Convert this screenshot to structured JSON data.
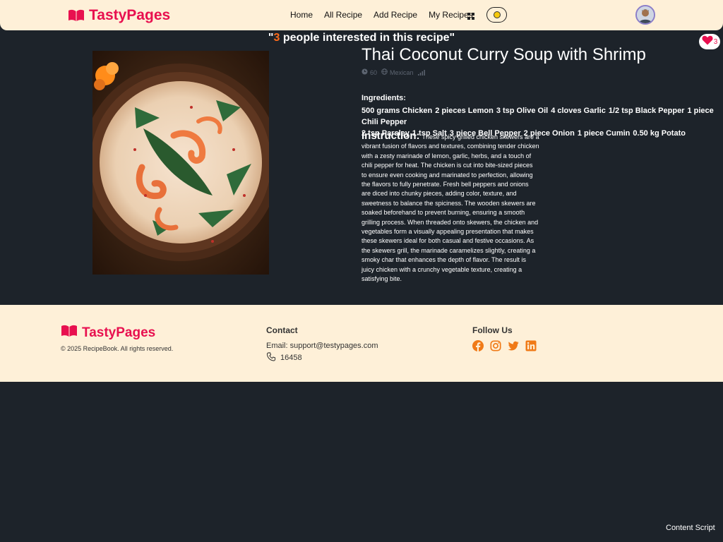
{
  "brand": {
    "name": "TastyPages",
    "color": "#e8104f"
  },
  "nav": {
    "links": [
      "Home",
      "All Recipe",
      "Add Recipe",
      "My Recipes"
    ]
  },
  "interest": {
    "quote_open": "\"",
    "count": "3",
    "text": " people interested in this recipe",
    "quote_close": "\""
  },
  "like": {
    "count": "3"
  },
  "recipe": {
    "title": "Thai Coconut Curry Soup with Shrimp",
    "time": "60",
    "cuisine": "Mexican",
    "ingredients_heading": "Ingredients:",
    "ingredients": [
      "500 grams Chicken",
      "2 pieces Lemon",
      "3 tsp Olive Oil",
      "4 cloves Garlic",
      "1/2 tsp Black Pepper",
      "1 piece Chili Pepper",
      "2 tsp Parsley",
      "1 tsp Salt",
      "3 piece Bell Pepper",
      "2 piece Onion",
      "1 piece Cumin",
      "0.50 kg Potato"
    ],
    "instruction_label": "Instruction:",
    "instruction_text": "These spicy grilled chicken skewers are a vibrant fusion of flavors and textures, combining tender chicken with a zesty marinade of lemon, garlic, herbs, and a touch of chili pepper for heat. The chicken is cut into bite-sized pieces to ensure even cooking and marinated to perfection, allowing the flavors to fully penetrate. Fresh bell peppers and onions are diced into chunky pieces, adding color, texture, and sweetness to balance the spiciness. The wooden skewers are soaked beforehand to prevent burning, ensuring a smooth grilling process. When threaded onto skewers, the chicken and vegetables form a visually appealing presentation that makes these skewers ideal for both casual and festive occasions. As the skewers grill, the marinade caramelizes slightly, creating a smoky char that enhances the depth of flavor. The result is juicy chicken with a crunchy vegetable texture, creating a satisfying bite."
  },
  "footer": {
    "brand": "TastyPages",
    "copyright": "© 2025 RecipeBook. All rights reserved.",
    "contact_heading": "Contact",
    "email": "Email: support@testypages.com",
    "phone": "16458",
    "follow_heading": "Follow Us",
    "social_color": "#f07a17",
    "socials": [
      "facebook-icon",
      "instagram-icon",
      "twitter-icon",
      "linkedin-icon"
    ]
  },
  "colors": {
    "background": "#1d232a",
    "navbar": "#fef0d8",
    "accent_orange": "#ff6b1a"
  },
  "extension_label": "Content Script"
}
